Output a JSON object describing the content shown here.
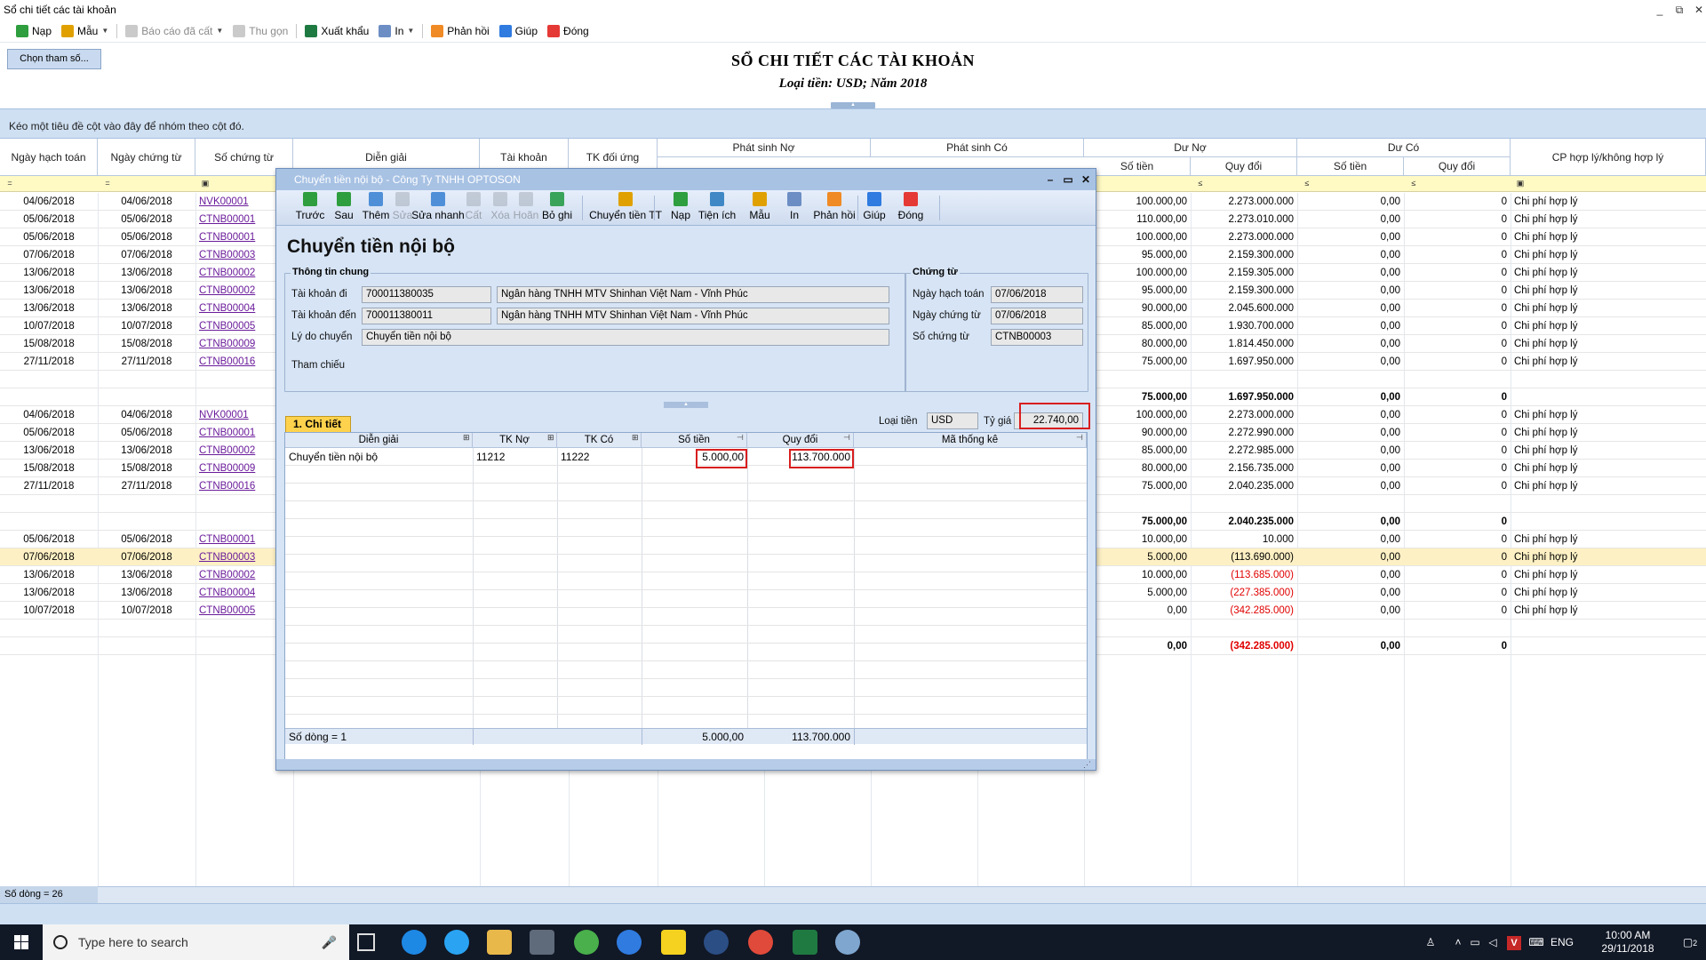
{
  "window": {
    "title": "Sổ chi tiết các tài khoản"
  },
  "toolbar": {
    "items": [
      {
        "label": "Nạp",
        "icon": "refresh-icon",
        "disabled": false
      },
      {
        "label": "Mẫu",
        "icon": "template-icon",
        "disabled": false
      },
      {
        "label": "Báo cáo đã cất",
        "icon": "saved-report-icon",
        "disabled": true
      },
      {
        "label": "Thu gọn",
        "icon": "collapse-icon",
        "disabled": true
      },
      {
        "label": "Xuất khẩu",
        "icon": "excel-icon",
        "disabled": false
      },
      {
        "label": "In",
        "icon": "print-icon",
        "disabled": false
      },
      {
        "label": "Phản hồi",
        "icon": "feedback-icon",
        "disabled": false
      },
      {
        "label": "Giúp",
        "icon": "help-icon",
        "disabled": false
      },
      {
        "label": "Đóng",
        "icon": "close-icon",
        "disabled": false
      }
    ]
  },
  "params_button": "Chọn tham số...",
  "report": {
    "title": "SỔ CHI TIẾT CÁC TÀI KHOẢN",
    "subtitle": "Loại tiền: USD; Năm 2018"
  },
  "group_panel_hint": "Kéo một tiêu đề cột vào đây để nhóm theo cột đó.",
  "grid": {
    "headers": {
      "ngay_hach_toan": "Ngày hạch toán",
      "ngay_chung_tu": "Ngày chứng từ",
      "so_chung_tu": "Số chứng từ",
      "dien_giai": "Diễn giải",
      "tai_khoan": "Tài khoản",
      "tk_doi_ung": "TK đối ứng",
      "phat_sinh_no": "Phát sinh Nợ",
      "phat_sinh_co": "Phát sinh Có",
      "du_no": "Dư Nợ",
      "du_co": "Dư Có",
      "so_tien": "Số tiền",
      "quy_doi": "Quy đổi",
      "cp": "CP hợp lý/không hợp lý"
    },
    "rows": [
      {
        "ngay": "04/06/2018",
        "ngayct": "04/06/2018",
        "soct": "NVK00001",
        "dn_tien": "100.000,00",
        "dn_qd": "2.273.000.000",
        "dc_tien": "0,00",
        "dc_qd": "0",
        "cp": "Chi phí hợp lý"
      },
      {
        "ngay": "05/06/2018",
        "ngayct": "05/06/2018",
        "soct": "CTNB00001",
        "dn_tien": "110.000,00",
        "dn_qd": "2.273.010.000",
        "dc_tien": "0,00",
        "dc_qd": "0",
        "cp": "Chi phí hợp lý"
      },
      {
        "ngay": "05/06/2018",
        "ngayct": "05/06/2018",
        "soct": "CTNB00001",
        "dn_tien": "100.000,00",
        "dn_qd": "2.273.000.000",
        "dc_tien": "0,00",
        "dc_qd": "0",
        "cp": "Chi phí hợp lý"
      },
      {
        "ngay": "07/06/2018",
        "ngayct": "07/06/2018",
        "soct": "CTNB00003",
        "dn_tien": "95.000,00",
        "dn_qd": "2.159.300.000",
        "dc_tien": "0,00",
        "dc_qd": "0",
        "cp": "Chi phí hợp lý"
      },
      {
        "ngay": "13/06/2018",
        "ngayct": "13/06/2018",
        "soct": "CTNB00002",
        "dn_tien": "100.000,00",
        "dn_qd": "2.159.305.000",
        "dc_tien": "0,00",
        "dc_qd": "0",
        "cp": "Chi phí hợp lý"
      },
      {
        "ngay": "13/06/2018",
        "ngayct": "13/06/2018",
        "soct": "CTNB00002",
        "dn_tien": "95.000,00",
        "dn_qd": "2.159.300.000",
        "dc_tien": "0,00",
        "dc_qd": "0",
        "cp": "Chi phí hợp lý"
      },
      {
        "ngay": "13/06/2018",
        "ngayct": "13/06/2018",
        "soct": "CTNB00004",
        "dn_tien": "90.000,00",
        "dn_qd": "2.045.600.000",
        "dc_tien": "0,00",
        "dc_qd": "0",
        "cp": "Chi phí hợp lý"
      },
      {
        "ngay": "10/07/2018",
        "ngayct": "10/07/2018",
        "soct": "CTNB00005",
        "dn_tien": "85.000,00",
        "dn_qd": "1.930.700.000",
        "dc_tien": "0,00",
        "dc_qd": "0",
        "cp": "Chi phí hợp lý"
      },
      {
        "ngay": "15/08/2018",
        "ngayct": "15/08/2018",
        "soct": "CTNB00009",
        "dn_tien": "80.000,00",
        "dn_qd": "1.814.450.000",
        "dc_tien": "0,00",
        "dc_qd": "0",
        "cp": "Chi phí hợp lý"
      },
      {
        "ngay": "27/11/2018",
        "ngayct": "27/11/2018",
        "soct": "CTNB00016",
        "dn_tien": "75.000,00",
        "dn_qd": "1.697.950.000",
        "dc_tien": "0,00",
        "dc_qd": "0",
        "cp": "Chi phí hợp lý"
      },
      {
        "blank": true
      },
      {
        "total": true,
        "dn_tien": "75.000,00",
        "dn_qd": "1.697.950.000",
        "dc_tien": "0,00",
        "dc_qd": "0"
      },
      {
        "ngay": "04/06/2018",
        "ngayct": "04/06/2018",
        "soct": "NVK00001",
        "dn_tien": "100.000,00",
        "dn_qd": "2.273.000.000",
        "dc_tien": "0,00",
        "dc_qd": "0",
        "cp": "Chi phí hợp lý"
      },
      {
        "ngay": "05/06/2018",
        "ngayct": "05/06/2018",
        "soct": "CTNB00001",
        "dn_tien": "90.000,00",
        "dn_qd": "2.272.990.000",
        "dc_tien": "0,00",
        "dc_qd": "0",
        "cp": "Chi phí hợp lý"
      },
      {
        "ngay": "13/06/2018",
        "ngayct": "13/06/2018",
        "soct": "CTNB00002",
        "dn_tien": "85.000,00",
        "dn_qd": "2.272.985.000",
        "dc_tien": "0,00",
        "dc_qd": "0",
        "cp": "Chi phí hợp lý"
      },
      {
        "ngay": "15/08/2018",
        "ngayct": "15/08/2018",
        "soct": "CTNB00009",
        "dn_tien": "80.000,00",
        "dn_qd": "2.156.735.000",
        "dc_tien": "0,00",
        "dc_qd": "0",
        "cp": "Chi phí hợp lý"
      },
      {
        "ngay": "27/11/2018",
        "ngayct": "27/11/2018",
        "soct": "CTNB00016",
        "dn_tien": "75.000,00",
        "dn_qd": "2.040.235.000",
        "dc_tien": "0,00",
        "dc_qd": "0",
        "cp": "Chi phí hợp lý"
      },
      {
        "blank": true
      },
      {
        "total": true,
        "dn_tien": "75.000,00",
        "dn_qd": "2.040.235.000",
        "dc_tien": "0,00",
        "dc_qd": "0"
      },
      {
        "ngay": "05/06/2018",
        "ngayct": "05/06/2018",
        "soct": "CTNB00001",
        "dn_tien": "10.000,00",
        "dn_qd": "10.000",
        "dc_tien": "0,00",
        "dc_qd": "0",
        "cp": "Chi phí hợp lý"
      },
      {
        "ngay": "07/06/2018",
        "ngayct": "07/06/2018",
        "soct": "CTNB00003",
        "dn_tien": "5.000,00",
        "dn_qd": "(113.690.000)",
        "dc_tien": "0,00",
        "dc_qd": "0",
        "cp": "Chi phí hợp lý",
        "selected": true
      },
      {
        "ngay": "13/06/2018",
        "ngayct": "13/06/2018",
        "soct": "CTNB00002",
        "dn_tien": "10.000,00",
        "dn_qd": "(113.685.000)",
        "dc_tien": "0,00",
        "dc_qd": "0",
        "cp": "Chi phí hợp lý",
        "neg": true
      },
      {
        "ngay": "13/06/2018",
        "ngayct": "13/06/2018",
        "soct": "CTNB00004",
        "dn_tien": "5.000,00",
        "dn_qd": "(227.385.000)",
        "dc_tien": "0,00",
        "dc_qd": "0",
        "cp": "Chi phí hợp lý",
        "neg": true
      },
      {
        "ngay": "10/07/2018",
        "ngayct": "10/07/2018",
        "soct": "CTNB00005",
        "dn_tien": "0,00",
        "dn_qd": "(342.285.000)",
        "dc_tien": "0,00",
        "dc_qd": "0",
        "cp": "Chi phí hợp lý",
        "neg": true
      },
      {
        "blank": true
      },
      {
        "total": true,
        "dn_tien": "0,00",
        "dn_qd": "(342.285.000)",
        "dc_tien": "0,00",
        "dc_qd": "0",
        "neg": true
      }
    ]
  },
  "status": {
    "row_count": "Số dòng = 26"
  },
  "dialog": {
    "title": "Chuyển tiền nội bộ - Công Ty TNHH OPTOSON",
    "toolbar": [
      {
        "label": "Trước",
        "icon": "prev-arrow-icon",
        "disabled": false
      },
      {
        "label": "Sau",
        "icon": "next-arrow-icon",
        "disabled": false
      },
      {
        "label": "Thêm",
        "icon": "add-doc-icon",
        "disabled": false
      },
      {
        "label": "Sửa",
        "icon": "edit-doc-icon",
        "disabled": true
      },
      {
        "label": "Sửa nhanh",
        "icon": "quick-edit-icon",
        "disabled": false
      },
      {
        "label": "Cất",
        "icon": "save-icon",
        "disabled": true
      },
      {
        "label": "Xóa",
        "icon": "delete-icon",
        "disabled": true
      },
      {
        "label": "Hoãn",
        "icon": "undo-icon",
        "disabled": true
      },
      {
        "label": "Bỏ ghi",
        "icon": "unpost-icon",
        "disabled": false
      },
      {
        "label": "Chuyển tiền TT",
        "icon": "transfer-icon",
        "disabled": false
      },
      {
        "label": "Nạp",
        "icon": "refresh-icon",
        "disabled": false
      },
      {
        "label": "Tiện ích",
        "icon": "utility-icon",
        "disabled": false
      },
      {
        "label": "Mẫu",
        "icon": "template-icon",
        "disabled": false
      },
      {
        "label": "In",
        "icon": "print-icon",
        "disabled": false
      },
      {
        "label": "Phản hồi",
        "icon": "feedback-icon",
        "disabled": false
      },
      {
        "label": "Giúp",
        "icon": "help-icon",
        "disabled": false
      },
      {
        "label": "Đóng",
        "icon": "close-icon",
        "disabled": false
      }
    ],
    "heading": "Chuyển tiền nội bộ",
    "general": {
      "group_label": "Thông tin chung",
      "tk_di_label": "Tài khoản đi",
      "tk_di_value": "700011380035",
      "tk_di_bank": "Ngân hàng TNHH MTV Shinhan Việt Nam - Vĩnh Phúc",
      "tk_den_label": "Tài khoản đến",
      "tk_den_value": "700011380011",
      "tk_den_bank": "Ngân hàng TNHH MTV Shinhan Việt Nam - Vĩnh Phúc",
      "ly_do_label": "Lý do chuyển",
      "ly_do_value": "Chuyển tiền nội bộ",
      "tham_chieu_label": "Tham chiếu"
    },
    "voucher": {
      "group_label": "Chứng từ",
      "ngay_ht_label": "Ngày hạch toán",
      "ngay_ht_value": "07/06/2018",
      "ngay_ct_label": "Ngày chứng từ",
      "ngay_ct_value": "07/06/2018",
      "so_ct_label": "Số chứng từ",
      "so_ct_value": "CTNB00003"
    },
    "currency": {
      "label": "Loại tiền",
      "value": "USD",
      "rate_label": "Tỷ giá",
      "rate_value": "22.740,00"
    },
    "tab": "1. Chi tiết",
    "detail": {
      "headers": {
        "dien_giai": "Diễn giải",
        "tk_no": "TK Nợ",
        "tk_co": "TK Có",
        "so_tien": "Số tiền",
        "quy_doi": "Quy đổi",
        "ma_thong_ke": "Mã thống kê"
      },
      "rows": [
        {
          "dien_giai": "Chuyển tiền nội bộ",
          "tk_no": "11212",
          "tk_co": "11222",
          "so_tien": "5.000,00",
          "quy_doi": "113.700.000"
        }
      ],
      "footer": {
        "row_count": "Số dòng = 1",
        "so_tien": "5.000,00",
        "quy_doi": "113.700.000"
      }
    }
  },
  "taskbar": {
    "search_placeholder": "Type here to search",
    "language": "ENG",
    "time": "10:00 AM",
    "date": "29/11/2018",
    "notification_count": "2"
  },
  "colors": {
    "accent": "#cfe0f3",
    "link": "#6a1b9a",
    "negative": "#e00000",
    "highlight": "#d91e1e",
    "selected_row": "#fdf0c4",
    "filter_row": "#fff9c4"
  }
}
